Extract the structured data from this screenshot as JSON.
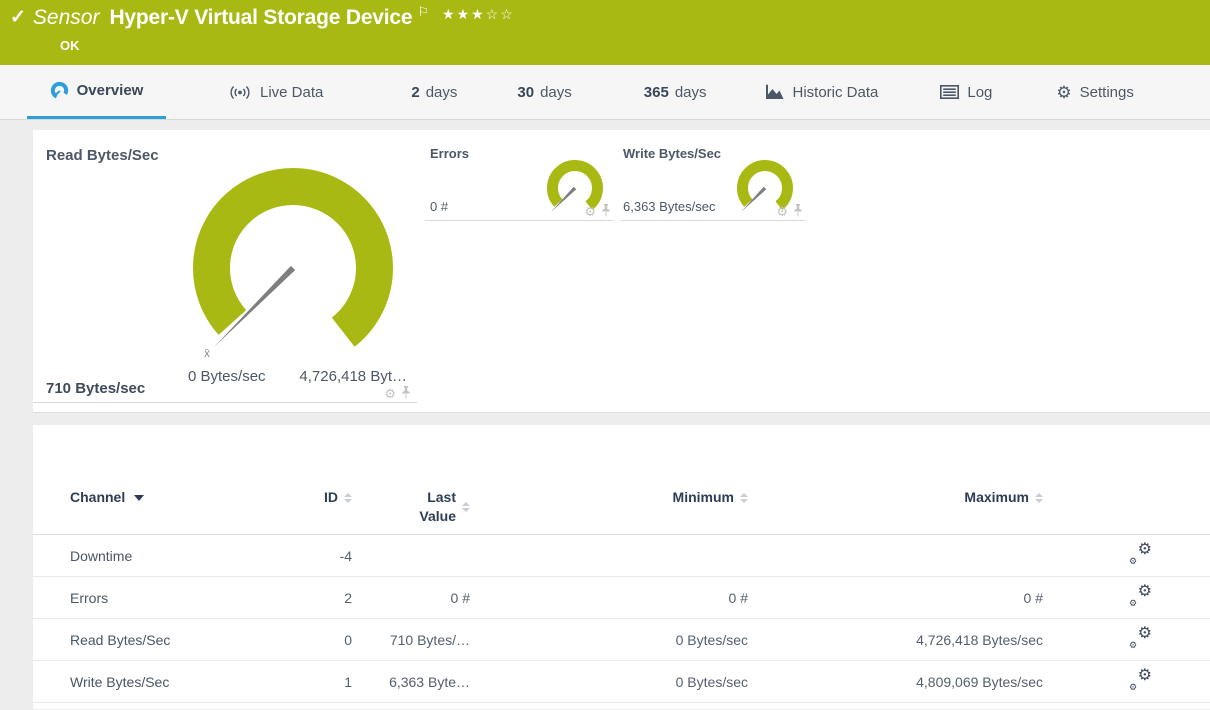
{
  "header": {
    "type_label": "Sensor",
    "title": "Hyper-V Virtual Storage Device",
    "status": "OK",
    "rating": "★★★☆☆",
    "status_color": "#a9b913"
  },
  "tabs": {
    "overview": {
      "label": "Overview"
    },
    "live_data": {
      "label": "Live Data"
    },
    "days2": {
      "num": "2",
      "label": "days"
    },
    "days30": {
      "num": "30",
      "label": "days"
    },
    "days365": {
      "num": "365",
      "label": "days"
    },
    "historic": {
      "label": "Historic Data"
    },
    "log": {
      "label": "Log"
    },
    "settings": {
      "label": "Settings"
    }
  },
  "chart_data": {
    "type": "gauge-set",
    "gauge_color": "#a9b913",
    "needle_color": "#7e7e7e",
    "gauges": [
      {
        "name": "Read Bytes/Sec",
        "value": 710,
        "unit": "Bytes/sec",
        "min": 0,
        "max": 4726418
      },
      {
        "name": "Errors",
        "value": 0,
        "unit": "#"
      },
      {
        "name": "Write Bytes/Sec",
        "value": 6363,
        "unit": "Bytes/sec"
      }
    ]
  },
  "gauges": {
    "primary": {
      "name": "Read Bytes/Sec",
      "value": "710 Bytes/sec",
      "scale_min": "0 Bytes/sec",
      "scale_max": "4,726,418 Byt…",
      "avg_marker": "x̄"
    },
    "errors": {
      "name": "Errors",
      "value": "0 #"
    },
    "write": {
      "name": "Write Bytes/Sec",
      "value": "6,363 Bytes/sec"
    }
  },
  "table": {
    "columns": {
      "channel": "Channel",
      "id": "ID",
      "last_value": "Last Value",
      "minimum": "Minimum",
      "maximum": "Maximum"
    },
    "rows": [
      {
        "channel": "Downtime",
        "id": "-4",
        "last": "",
        "min": "",
        "max": ""
      },
      {
        "channel": "Errors",
        "id": "2",
        "last": "0 #",
        "min": "0 #",
        "max": "0 #"
      },
      {
        "channel": "Read Bytes/Sec",
        "id": "0",
        "last": "710 Bytes/…",
        "min": "0 Bytes/sec",
        "max": "4,726,418 Bytes/sec"
      },
      {
        "channel": "Write Bytes/Sec",
        "id": "1",
        "last": "6,363 Byte…",
        "min": "0 Bytes/sec",
        "max": "4,809,069 Bytes/sec"
      }
    ]
  }
}
